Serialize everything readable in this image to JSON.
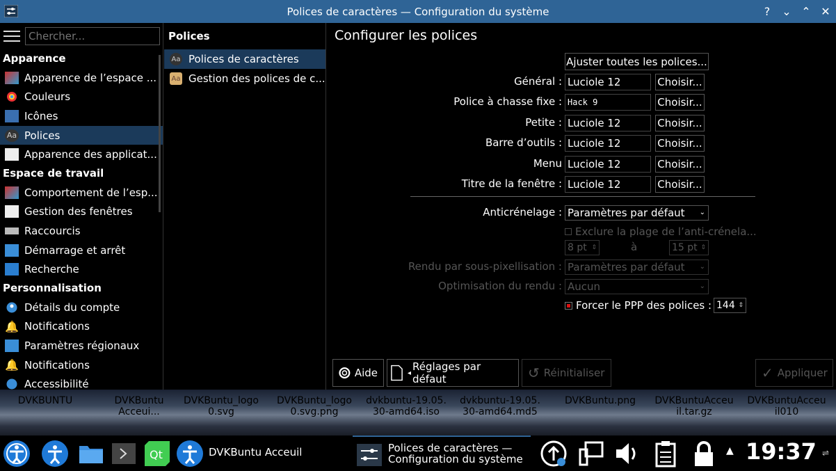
{
  "window": {
    "title": "Polices de caractères — Configuration du système",
    "controls": [
      "?",
      "⌄",
      "⌃",
      "✕"
    ]
  },
  "sidebar": {
    "search_placeholder": "Chercher...",
    "sections": [
      {
        "title": "Apparence",
        "items": [
          {
            "label": "Apparence de l’espace ...",
            "icon": "appearance-icon"
          },
          {
            "label": "Couleurs",
            "icon": "colors-icon"
          },
          {
            "label": "Icônes",
            "icon": "icons-icon"
          },
          {
            "label": "Polices",
            "icon": "fonts-icon",
            "active": true
          },
          {
            "label": "Apparence des applicat...",
            "icon": "app-style-icon"
          }
        ]
      },
      {
        "title": "Espace de travail",
        "items": [
          {
            "label": "Comportement de l’esp...",
            "icon": "workspace-icon"
          },
          {
            "label": "Gestion des fenêtres",
            "icon": "window-mgmt-icon"
          },
          {
            "label": "Raccourcis",
            "icon": "keyboard-icon"
          },
          {
            "label": "Démarrage et arrêt",
            "icon": "startup-icon"
          },
          {
            "label": "Recherche",
            "icon": "search-icon"
          }
        ]
      },
      {
        "title": "Personnalisation",
        "items": [
          {
            "label": "Détails du compte",
            "icon": "account-icon"
          },
          {
            "label": "Notifications",
            "icon": "bell-icon"
          },
          {
            "label": "Paramètres régionaux",
            "icon": "regional-icon"
          },
          {
            "label": "Notifications",
            "icon": "bell-icon"
          },
          {
            "label": "Accessibilité",
            "icon": "accessibility-icon"
          }
        ]
      }
    ]
  },
  "middle": {
    "title": "Polices",
    "items": [
      {
        "label": "Polices de caractères",
        "active": true
      },
      {
        "label": "Gestion des polices de c..."
      }
    ]
  },
  "main": {
    "title": "Configurer les polices",
    "adjust_all": "Ajuster toutes les polices...",
    "choose_label": "Choisir...",
    "fonts": [
      {
        "label": "Général :",
        "value": "Luciole 12"
      },
      {
        "label": "Police à chasse fixe :",
        "value": "Hack 9"
      },
      {
        "label": "Petite :",
        "value": "Luciole 12"
      },
      {
        "label": "Barre d’outils :",
        "value": "Luciole 12"
      },
      {
        "label": "Menu",
        "value": "Luciole 12"
      },
      {
        "label": "Titre de la fenêtre :",
        "value": "Luciole 12"
      }
    ],
    "antialias_label": "Anticrénelage :",
    "antialias_value": "Paramètres par défaut",
    "exclude_label": "Exclure la plage de l’anti-crénela...",
    "range_from": "8 pt",
    "range_to_label": "à",
    "range_to": "15 pt",
    "subpixel_label": "Rendu par sous-pixellisation :",
    "subpixel_value": "Paramètres par défaut",
    "hinting_label": "Optimisation du rendu :",
    "hinting_value": "Aucun",
    "force_dpi_label": "Forcer le PPP des polices :",
    "force_dpi_value": "144",
    "buttons": {
      "help": "Aide",
      "defaults": "Réglages par défaut",
      "reset": "Réinitialiser",
      "apply": "Appliquer"
    }
  },
  "desktop": {
    "items": [
      [
        "DVKBUNTU"
      ],
      [
        "DVKBuntu",
        "Acceui..."
      ],
      [
        "DVKBuntu_logo",
        "0.svg"
      ],
      [
        "DVKBuntu_logo",
        "0.svg.png"
      ],
      [
        "dvkbuntu-19.05.",
        "30-amd64.iso"
      ],
      [
        "dvkbuntu-19.05.",
        "30-amd64.md5"
      ],
      [
        "DVKBuntu.png"
      ],
      [
        "DVKBuntuAcceu",
        "il.tar.gz"
      ],
      [
        "DVKBuntuAcceu",
        "il010"
      ]
    ]
  },
  "taskbar": {
    "task1": "DVKBuntu Acceuil",
    "task2_line1": "Polices de caractères —",
    "task2_line2": "Configuration du système",
    "clock": "19:37"
  },
  "colors": {
    "titlebar": "#2f6496",
    "selection": "#1b3a5a",
    "accent_red": "#d11"
  }
}
